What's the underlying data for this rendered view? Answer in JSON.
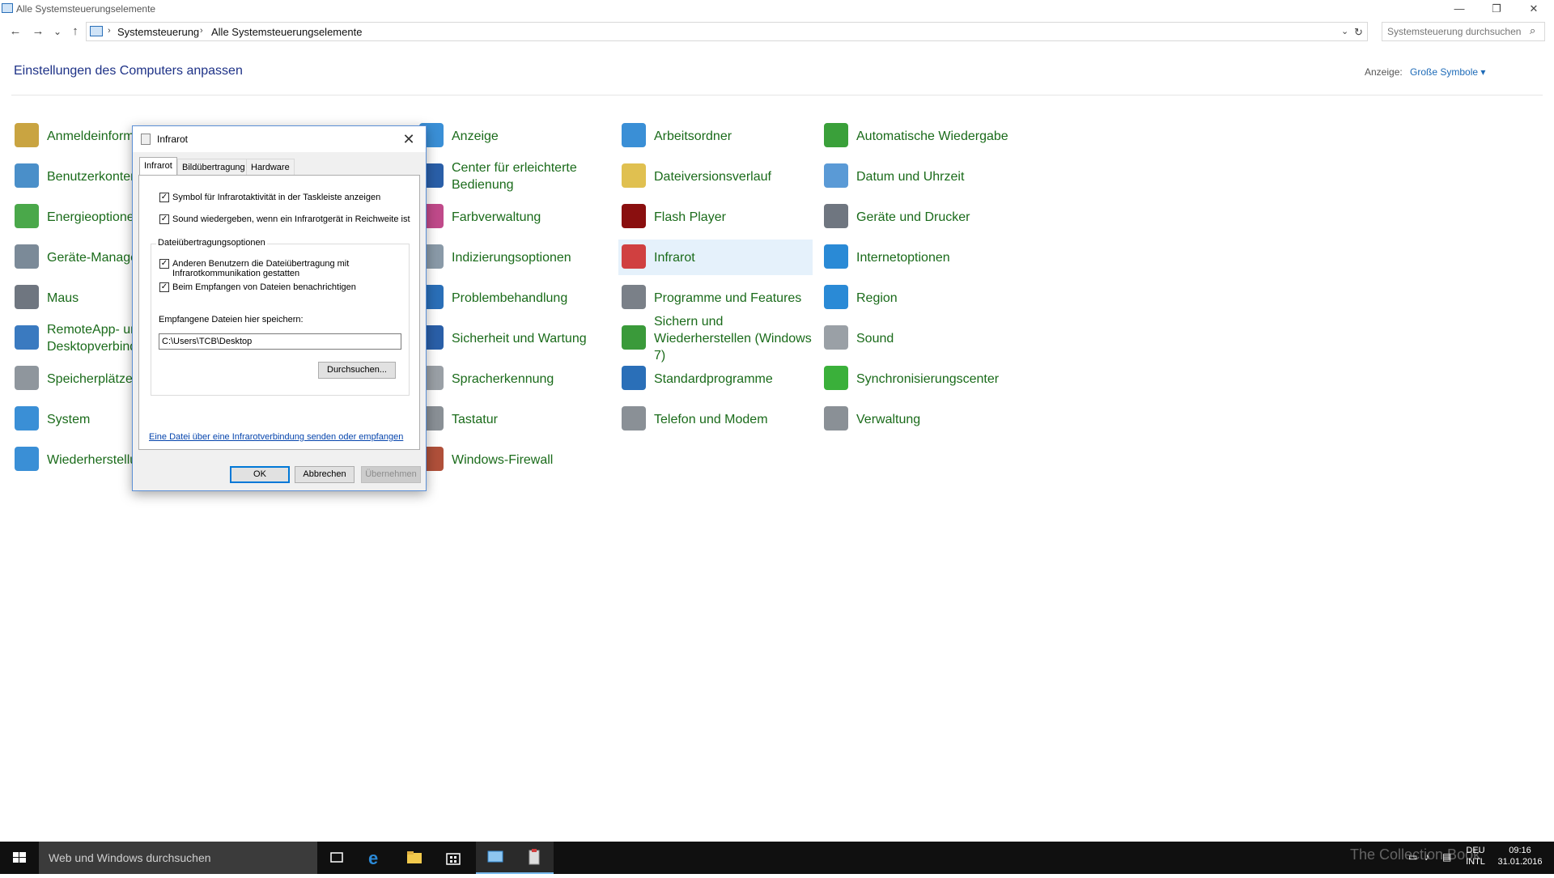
{
  "window": {
    "title": "Alle Systemsteuerungselemente",
    "minimize": "—",
    "restore": "❐",
    "close": "✕"
  },
  "nav": {
    "back": "←",
    "forward": "→",
    "recent": "⌄",
    "up": "↑",
    "refresh": "↻",
    "dropdown": "⌄"
  },
  "breadcrumb": [
    "Systemsteuerung",
    "Alle Systemsteuerungselemente"
  ],
  "search": {
    "placeholder": "Systemsteuerung durchsuchen"
  },
  "heading": "Einstellungen des Computers anpassen",
  "view": {
    "label": "Anzeige:",
    "value": "Große Symbole ▾"
  },
  "items": [
    {
      "label": "Anmeldeinformationsverwaltung",
      "icon": "credential-manager-icon",
      "color": "#c9a441"
    },
    {
      "label": "Benutzerkonten",
      "icon": "user-accounts-icon",
      "color": "#4a8fc9"
    },
    {
      "label": "Energieoptionen",
      "icon": "power-options-icon",
      "color": "#4aa84a"
    },
    {
      "label": "Geräte-Manager",
      "icon": "device-manager-icon",
      "color": "#7b8a98"
    },
    {
      "label": "Maus",
      "icon": "mouse-icon",
      "color": "#6f7680"
    },
    {
      "label": "RemoteApp- und Desktopverbindungen",
      "icon": "remoteapp-icon",
      "color": "#3a7ac0"
    },
    {
      "label": "Speicherplätze",
      "icon": "storage-spaces-icon",
      "color": "#8f969d"
    },
    {
      "label": "System",
      "icon": "system-icon",
      "color": "#3a8fd6"
    },
    {
      "label": "Wiederherstellung",
      "icon": "recovery-icon",
      "color": "#3a8fd6"
    },
    {
      "label": "Anzeige",
      "icon": "display-icon",
      "color": "#3a8fd6"
    },
    {
      "label": "Center für erleichterte Bedienung",
      "icon": "ease-of-access-icon",
      "color": "#2a5fa8"
    },
    {
      "label": "Farbverwaltung",
      "icon": "color-management-icon",
      "color": "#c04a8a"
    },
    {
      "label": "Indizierungsoptionen",
      "icon": "indexing-icon",
      "color": "#8a9aa8"
    },
    {
      "label": "Problembehandlung",
      "icon": "troubleshooting-icon",
      "color": "#2a6fb8"
    },
    {
      "label": "Sicherheit und Wartung",
      "icon": "security-maintenance-icon",
      "color": "#2a5fa8"
    },
    {
      "label": "Spracherkennung",
      "icon": "speech-recognition-icon",
      "color": "#9aa0a6"
    },
    {
      "label": "Tastatur",
      "icon": "keyboard-icon",
      "color": "#8a9096"
    },
    {
      "label": "Windows-Firewall",
      "icon": "firewall-icon",
      "color": "#b0503a"
    },
    {
      "label": "Arbeitsordner",
      "icon": "work-folders-icon",
      "color": "#3a8fd6"
    },
    {
      "label": "Dateiversionsverlauf",
      "icon": "file-history-icon",
      "color": "#e0c050"
    },
    {
      "label": "Flash Player",
      "icon": "flash-player-icon",
      "color": "#8a0f0f"
    },
    {
      "label": "Infrarot",
      "icon": "infrared-icon",
      "color": "#d04040"
    },
    {
      "label": "Programme und Features",
      "icon": "programs-features-icon",
      "color": "#7a8088"
    },
    {
      "label": "Sichern und Wiederherstellen (Windows 7)",
      "icon": "backup-restore-icon",
      "color": "#3a9a3a"
    },
    {
      "label": "Standardprogramme",
      "icon": "default-programs-icon",
      "color": "#2a6fb8"
    },
    {
      "label": "Telefon und Modem",
      "icon": "phone-modem-icon",
      "color": "#8a9096"
    },
    {
      "label": "Automatische Wiedergabe",
      "icon": "autoplay-icon",
      "color": "#3aa03a"
    },
    {
      "label": "Datum und Uhrzeit",
      "icon": "date-time-icon",
      "color": "#5a9ad6"
    },
    {
      "label": "Geräte und Drucker",
      "icon": "devices-printers-icon",
      "color": "#6f7680"
    },
    {
      "label": "Internetoptionen",
      "icon": "internet-options-icon",
      "color": "#2a8ad6"
    },
    {
      "label": "Region",
      "icon": "region-icon",
      "color": "#2a8ad6"
    },
    {
      "label": "Sound",
      "icon": "sound-icon",
      "color": "#9aa0a6"
    },
    {
      "label": "Synchronisierungscenter",
      "icon": "sync-center-icon",
      "color": "#3ab03a"
    },
    {
      "label": "Verwaltung",
      "icon": "administrative-tools-icon",
      "color": "#8a9096"
    }
  ],
  "dialog": {
    "title": "Infrarot",
    "close": "✕",
    "tabs": [
      "Infrarot",
      "Bildübertragung",
      "Hardware"
    ],
    "options": {
      "taskbar_symbol": {
        "label": "Symbol für Infrarotaktivität in der Taskleiste anzeigen",
        "checked": "✓"
      },
      "play_sound": {
        "label": "Sound wiedergeben, wenn ein Infrarotgerät in Reichweite ist",
        "checked": "✓"
      }
    },
    "group_title": "Dateiübertragungsoptionen",
    "group": {
      "allow_others": {
        "label": "Anderen Benutzern die Dateiübertragung mit Infrarotkommunikation gestatten",
        "checked": "✓"
      },
      "notify_receive": {
        "label": "Beim Empfangen von Dateien benachrichtigen",
        "checked": "✓"
      },
      "save_label": "Empfangene Dateien hier speichern:",
      "save_path": "C:\\Users\\TCB\\Desktop",
      "browse": "Durchsuchen..."
    },
    "link": "Eine Datei über eine Infrarotverbindung senden oder empfangen",
    "buttons": {
      "ok": "OK",
      "cancel": "Abbrechen",
      "apply": "Übernehmen"
    }
  },
  "taskbar": {
    "search_placeholder": "Web und Windows durchsuchen",
    "language": "DEU",
    "layout": "INTL",
    "time": "09:16",
    "date": "31.01.2016",
    "watermark": "The Collection Book",
    "accent": "#76b9ed"
  }
}
